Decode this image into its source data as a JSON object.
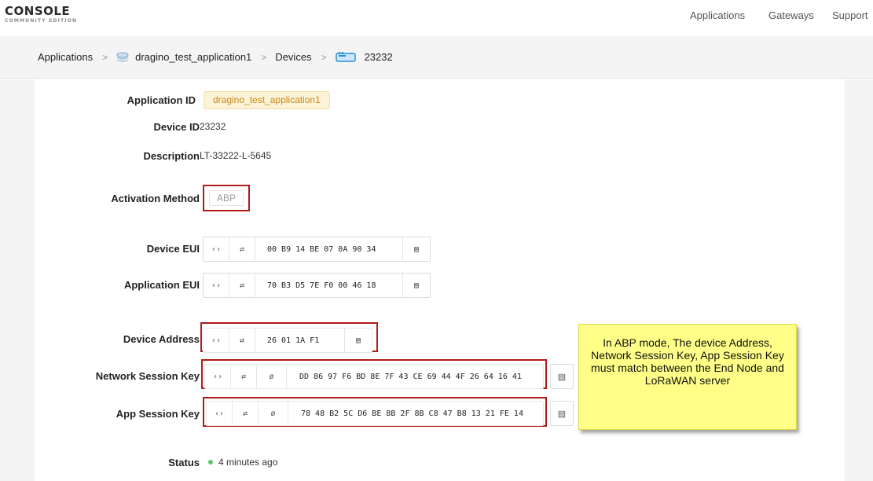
{
  "logo": {
    "title": "CONSOLE",
    "subtitle": "COMMUNITY EDITION"
  },
  "nav": {
    "applications": "Applications",
    "gateways": "Gateways",
    "support": "Support"
  },
  "breadcrumb": {
    "applications": "Applications",
    "app_name": "dragino_test_application1",
    "devices": "Devices",
    "device": "23232"
  },
  "fields": {
    "application_id_label": "Application ID",
    "application_id": "dragino_test_application1",
    "device_id_label": "Device ID",
    "device_id": "23232",
    "description_label": "Description",
    "description": "LT-33222-L-5645",
    "activation_method_label": "Activation Method",
    "activation_method": "ABP",
    "device_eui_label": "Device EUI",
    "device_eui": "00 B9 14 BE 07 0A 90 34",
    "application_eui_label": "Application EUI",
    "application_eui": "70 B3 D5 7E F0 00 46 18",
    "device_address_label": "Device Address",
    "device_address": "26 01 1A F1",
    "network_session_key_label": "Network Session Key",
    "network_session_key": "DD 86 97 F6 BD 8E 7F 43 CE 69 44 4F 26 64 16 41",
    "app_session_key_label": "App Session Key",
    "app_session_key": "78 48 B2 5C D6 BE 8B 2F 8B C8 47 B8 13 21 FE 14",
    "status_label": "Status",
    "status": "4 minutes ago"
  },
  "icons": {
    "toggle_format": "‹›",
    "byte_order": "⇄",
    "hidden": "ø",
    "copy": "▤"
  },
  "note": "In ABP mode, The device Address, Network Session Key, App Session Key must match between the End Node and LoRaWAN server",
  "colors": {
    "highlight_red": "#b11a1a",
    "note_yellow": "#ffff88",
    "status_green": "#5bc36a",
    "chip_text": "#c98a16"
  }
}
